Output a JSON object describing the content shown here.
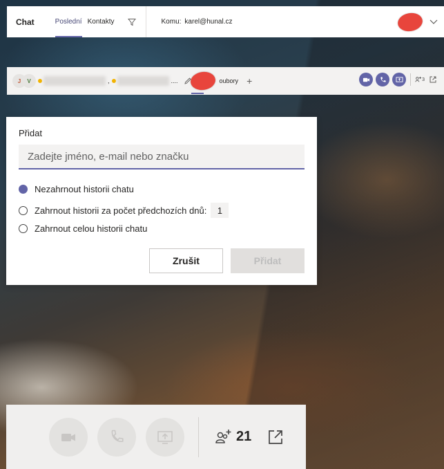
{
  "colors": {
    "accent": "#6264a7",
    "marker": "#e8453c",
    "presence": "#f2b300"
  },
  "header": {
    "title": "Chat",
    "tabs": [
      {
        "label": "Poslední",
        "active": true
      },
      {
        "label": "Kontakty",
        "active": false
      }
    ],
    "filter_icon": "filter-icon",
    "to_label": "Komu:",
    "to_value": "karel@hunal.cz",
    "chevron_icon": "chevron-down-icon"
  },
  "chat_bar": {
    "avatars": [
      {
        "initial": "J"
      },
      {
        "initial": "V"
      }
    ],
    "separator": ",",
    "ellipsis": "....",
    "tab_files": "oubory",
    "plus_label": "+",
    "people_count": "3"
  },
  "dialog": {
    "title": "Přidat",
    "search_placeholder": "Zadejte jméno, e-mail nebo značku",
    "options": [
      {
        "label": "Nezahrnout historii chatu",
        "checked": true
      },
      {
        "label": "Zahrnout historii za počet předchozích dnů:",
        "checked": false
      },
      {
        "label": "Zahrnout celou historii chatu",
        "checked": false
      }
    ],
    "days_value": "1",
    "cancel_label": "Zrušit",
    "add_label": "Přidat"
  },
  "bottom_bar": {
    "participants": "21"
  }
}
